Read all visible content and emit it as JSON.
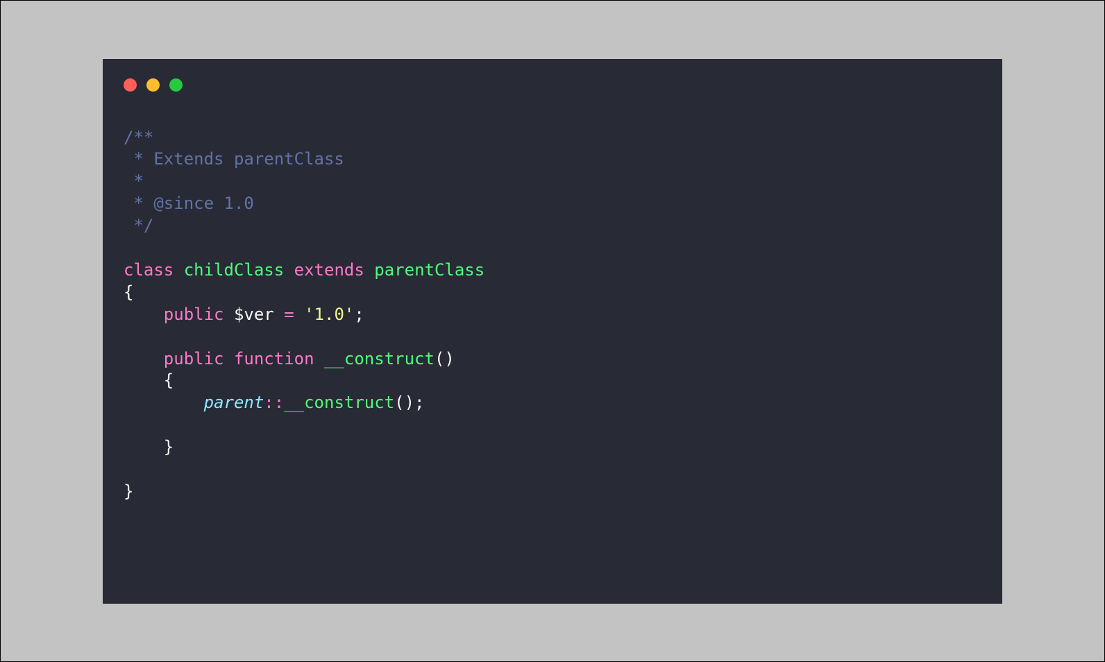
{
  "window": {
    "traffic_lights": {
      "red": "#ff5f56",
      "yellow": "#ffbd2e",
      "green": "#27c93f"
    }
  },
  "code": {
    "lines": [
      {
        "tokens": [
          {
            "cls": "comment",
            "t": "/**"
          }
        ]
      },
      {
        "tokens": [
          {
            "cls": "comment",
            "t": " * Extends parentClass"
          }
        ]
      },
      {
        "tokens": [
          {
            "cls": "comment",
            "t": " *"
          }
        ]
      },
      {
        "tokens": [
          {
            "cls": "comment",
            "t": " * @since 1.0"
          }
        ]
      },
      {
        "tokens": [
          {
            "cls": "comment",
            "t": " */"
          }
        ]
      },
      {
        "tokens": [
          {
            "cls": "punct",
            "t": ""
          }
        ]
      },
      {
        "tokens": [
          {
            "cls": "keyword",
            "t": "class"
          },
          {
            "cls": "punct",
            "t": " "
          },
          {
            "cls": "classname",
            "t": "childClass"
          },
          {
            "cls": "punct",
            "t": " "
          },
          {
            "cls": "keyword",
            "t": "extends"
          },
          {
            "cls": "punct",
            "t": " "
          },
          {
            "cls": "classname",
            "t": "parentClass"
          }
        ]
      },
      {
        "tokens": [
          {
            "cls": "punct",
            "t": "{"
          }
        ]
      },
      {
        "tokens": [
          {
            "cls": "punct",
            "t": "    "
          },
          {
            "cls": "keyword",
            "t": "public"
          },
          {
            "cls": "punct",
            "t": " $ver "
          },
          {
            "cls": "keyword",
            "t": "="
          },
          {
            "cls": "punct",
            "t": " "
          },
          {
            "cls": "string",
            "t": "'1.0'"
          },
          {
            "cls": "punct",
            "t": ";"
          }
        ]
      },
      {
        "tokens": [
          {
            "cls": "punct",
            "t": ""
          }
        ]
      },
      {
        "tokens": [
          {
            "cls": "punct",
            "t": "    "
          },
          {
            "cls": "keyword",
            "t": "public"
          },
          {
            "cls": "punct",
            "t": " "
          },
          {
            "cls": "keyword",
            "t": "function"
          },
          {
            "cls": "punct",
            "t": " "
          },
          {
            "cls": "construct",
            "t": "__construct"
          },
          {
            "cls": "punct",
            "t": "()"
          }
        ]
      },
      {
        "tokens": [
          {
            "cls": "punct",
            "t": "    {"
          }
        ]
      },
      {
        "tokens": [
          {
            "cls": "punct",
            "t": "        "
          },
          {
            "cls": "type",
            "t": "parent"
          },
          {
            "cls": "keyword",
            "t": "::"
          },
          {
            "cls": "construct",
            "t": "__construct"
          },
          {
            "cls": "punct",
            "t": "();"
          }
        ]
      },
      {
        "tokens": [
          {
            "cls": "punct",
            "t": ""
          }
        ]
      },
      {
        "tokens": [
          {
            "cls": "punct",
            "t": "    }"
          }
        ]
      },
      {
        "tokens": [
          {
            "cls": "punct",
            "t": ""
          }
        ]
      },
      {
        "tokens": [
          {
            "cls": "punct",
            "t": "}"
          }
        ]
      }
    ]
  }
}
